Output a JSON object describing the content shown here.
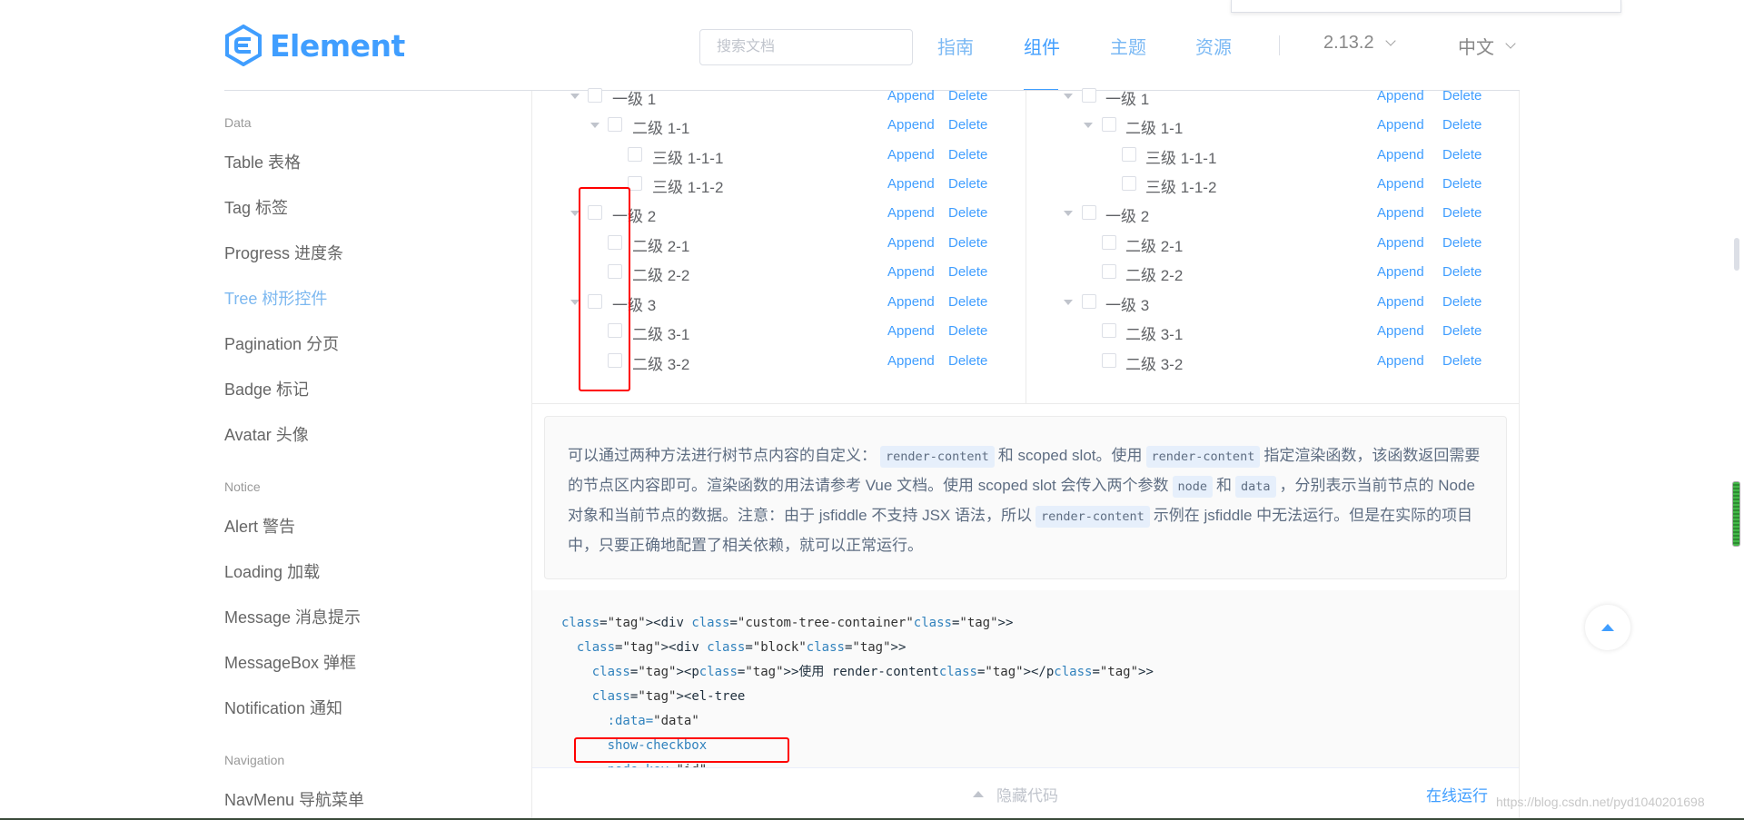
{
  "header": {
    "logo_text": "Element",
    "search_placeholder": "搜索文档",
    "nav": [
      "指南",
      "组件",
      "主题",
      "资源"
    ],
    "version": "2.13.2",
    "language": "中文"
  },
  "sidebar": {
    "groups": [
      "Data",
      "Notice",
      "Navigation"
    ],
    "items": [
      "Table 表格",
      "Tag 标签",
      "Progress 进度条",
      "Tree 树形控件",
      "Pagination 分页",
      "Badge 标记",
      "Avatar 头像",
      "Alert 警告",
      "Loading 加载",
      "Message 消息提示",
      "MessageBox 弹框",
      "Notification 通知",
      "NavMenu 导航菜单"
    ]
  },
  "tree_nodes": [
    "一级 1",
    "二级 1-1",
    "三级 1-1-1",
    "三级 1-1-2",
    "一级 2",
    "二级 2-1",
    "二级 2-2",
    "一级 3",
    "二级 3-1",
    "二级 3-2"
  ],
  "tree_actions": {
    "append": "Append",
    "delete": "Delete"
  },
  "description": {
    "p1": "可以通过两种方法进行树节点内容的自定义：",
    "code1": "render-content",
    "p2": "和 scoped slot。使用",
    "code2": "render-content",
    "p3": "指定渲染函数，该函数返回需要的节点区内容即可。渲染函数的用法请参考 Vue 文档。使用 scoped slot 会传入两个参数",
    "code3": "node",
    "p4": "和",
    "code4": "data",
    "p5": "，分别表示当前节点的 Node 对象和当前节点的数据。注意：由于 jsfiddle 不支持 JSX 语法，所以",
    "code5": "render-content",
    "p6": "示例在 jsfiddle 中无法运行。但是在实际的项目中，只要正确地配置了相关依赖，就可以正常运行。"
  },
  "code_lines": [
    "<div class=\"custom-tree-container\">",
    "  <div class=\"block\">",
    "    <p>使用 render-content</p>",
    "    <el-tree",
    "      :data=\"data\"",
    "      show-checkbox",
    "      node-key=\"id\""
  ],
  "code_bar": {
    "hide_code": "隐藏代码",
    "run_online": "在线运行"
  },
  "watermark": "https://blog.csdn.net/pyd1040201698",
  "colors": {
    "primary": "#409eff",
    "highlight_red": "#ff0000"
  }
}
